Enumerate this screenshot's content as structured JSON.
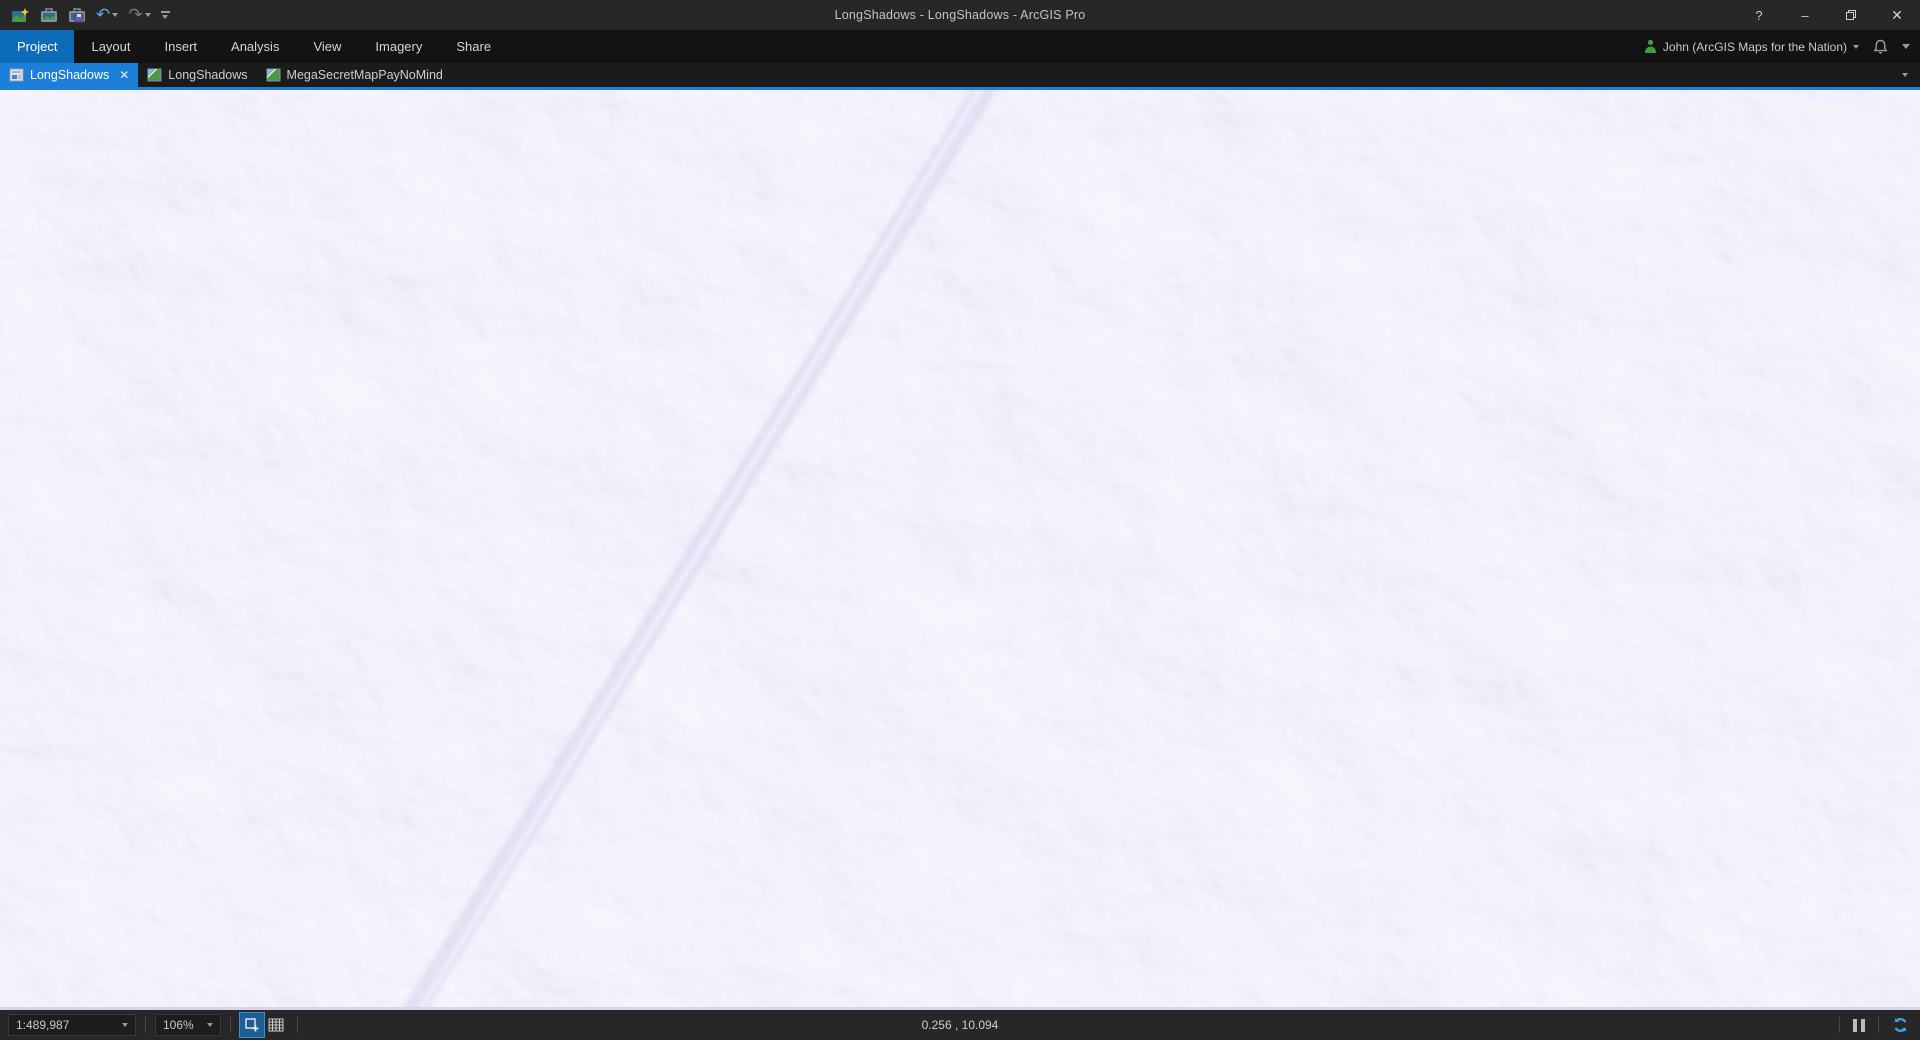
{
  "window": {
    "title": "LongShadows - LongShadows - ArcGIS Pro",
    "controls": {
      "help": "?",
      "minimize": "–",
      "close": "✕"
    }
  },
  "icons": {
    "undo": "↶",
    "redo": "↷",
    "tab_close": "✕"
  },
  "ribbon": {
    "tabs": [
      {
        "label": "Project",
        "active": true
      },
      {
        "label": "Layout"
      },
      {
        "label": "Insert"
      },
      {
        "label": "Analysis"
      },
      {
        "label": "View"
      },
      {
        "label": "Imagery"
      },
      {
        "label": "Share"
      }
    ]
  },
  "account": {
    "user_label": "John (ArcGIS Maps for the Nation)"
  },
  "document_tabs": [
    {
      "label": "LongShadows",
      "active": true,
      "closable": true
    },
    {
      "label": "LongShadows"
    },
    {
      "label": "MegaSecretMapPayNoMind"
    }
  ],
  "map": {
    "type": "hillshade terrain (lavender tint)",
    "colors": {
      "highlight": "#ffffff",
      "midtone": "#e2ddf4",
      "shadow": "#b2a8de"
    }
  },
  "status_bar": {
    "scale": "1:489,987",
    "zoom": "106%",
    "coordinates": "0.256 , 10.094"
  },
  "colors": {
    "accent_blue": "#1e7fd4",
    "ribbon_active_tab": "#0d6cba",
    "doc_active_tab": "#1b7fd9",
    "titlebar_bg": "#272727",
    "statusbar_bg": "#272727"
  }
}
